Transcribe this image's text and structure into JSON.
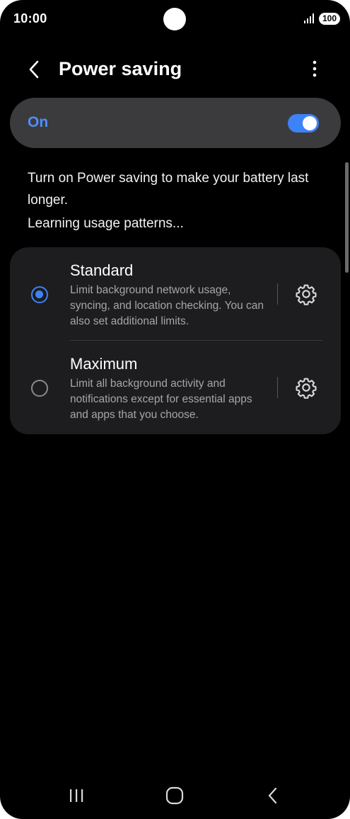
{
  "status_bar": {
    "time": "10:00",
    "battery": "100",
    "icons": [
      "camera-cutout",
      "signal-icon",
      "battery-icon"
    ]
  },
  "header": {
    "title": "Power saving",
    "back_icon": "chevron-left-icon",
    "more_icon": "more-vertical-icon"
  },
  "master_toggle": {
    "label": "On",
    "state": true
  },
  "description": "Turn on Power saving to make your battery last longer.",
  "learning_text": "Learning usage patterns...",
  "options": [
    {
      "title": "Standard",
      "description": "Limit background network usage, syncing, and location checking. You can also set additional limits.",
      "selected": true
    },
    {
      "title": "Maximum",
      "description": "Limit all background activity and notifications except for essential apps and apps that you choose.",
      "selected": false
    }
  ],
  "colors": {
    "accent": "#3e82f7",
    "toggle_label": "#4f8ff7",
    "background": "#000000",
    "card": "#1d1d1f",
    "toggle_bar": "#3b3b3d",
    "secondary_text": "#a6a6a6"
  },
  "nav_bar": {
    "icons": [
      "recents-icon",
      "home-icon",
      "back-icon"
    ]
  }
}
